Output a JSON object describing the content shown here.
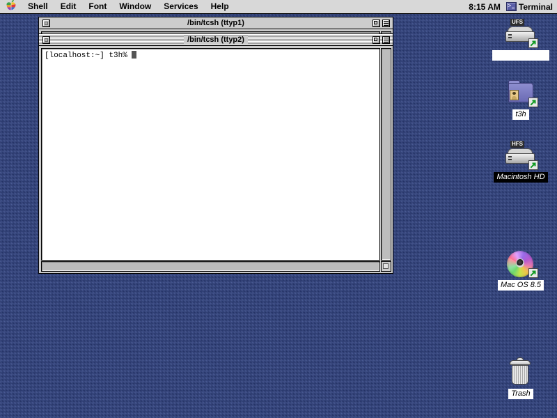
{
  "menubar": {
    "apple_icon": "apple-logo-icon",
    "items": [
      "Shell",
      "Edit",
      "Font",
      "Window",
      "Services",
      "Help"
    ],
    "clock": "8:15 AM",
    "app_menu": {
      "icon": "terminal-icon",
      "label": "Terminal"
    }
  },
  "windows": [
    {
      "id": "ttyp1",
      "title": "/bin/tcsh  (ttyp1)",
      "active": false,
      "close_icon": "close-box-icon",
      "zoom_icon": "zoom-box-icon",
      "collapse_icon": "collapse-box-icon"
    },
    {
      "id": "ttyp2",
      "title": "/bin/tcsh  (ttyp2)",
      "active": true,
      "close_icon": "close-box-icon",
      "zoom_icon": "zoom-box-icon",
      "collapse_icon": "collapse-box-icon",
      "terminal_text": "[localhost:~] t3h% "
    }
  ],
  "desktop_icons": [
    {
      "name": "ufs-volume",
      "label": "",
      "tag": "UFS",
      "kind": "hard-disk",
      "selected": false,
      "alias": true
    },
    {
      "name": "t3h-home-folder",
      "label": "t3h",
      "kind": "home-folder",
      "selected": false,
      "alias": true
    },
    {
      "name": "macintosh-hd",
      "label": "Macintosh HD",
      "tag": "HFS",
      "kind": "hard-disk",
      "selected": true,
      "alias": true
    },
    {
      "name": "mac-os-cd",
      "label": "Mac OS 8.5",
      "kind": "cd-rom",
      "selected": false,
      "alias": true
    },
    {
      "name": "trash",
      "label": "Trash",
      "kind": "trash-can",
      "selected": false,
      "alias": false
    }
  ],
  "colors": {
    "desktop": "#2f4180",
    "menubar": "#d8d8d8",
    "window_chrome": "#cccccc",
    "terminal_bg": "#ffffff",
    "selection": "#000000"
  }
}
